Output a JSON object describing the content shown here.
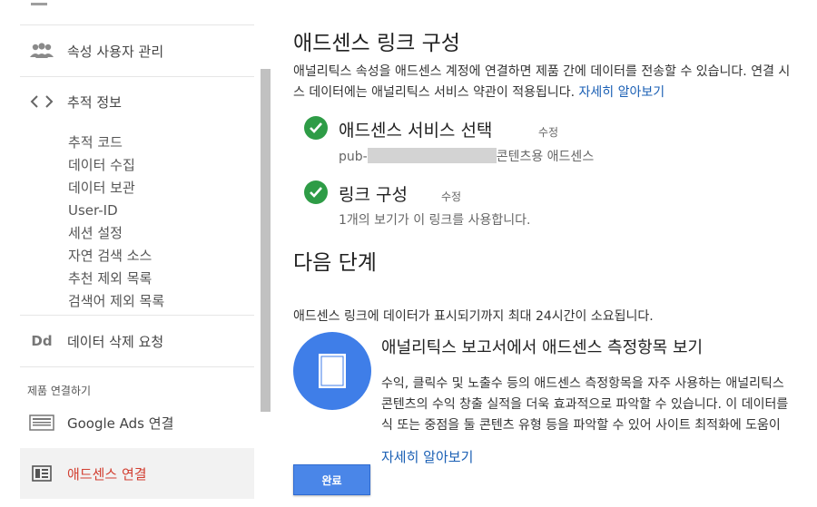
{
  "sidebar": {
    "user_management": "속성 사용자 관리",
    "tracking_info": "추적 정보",
    "tracking_subitems": [
      "추적 코드",
      "데이터 수집",
      "데이터 보관",
      "User-ID",
      "세션 설정",
      "자연 검색 소스",
      "추천 제외 목록",
      "검색어 제외 목록"
    ],
    "data_deletion": "데이터 삭제 요청",
    "section_label": "제품 연결하기",
    "google_ads": "Google Ads 연결",
    "adsense": "애드센스 연결"
  },
  "main": {
    "title": "애드센스 링크 구성",
    "desc_line1": "애널리틱스 속성을 애드센스 계정에 연결하면 제품 간에 데이터를 전송할 수 있습니다. 연결 시",
    "desc_line2": "스 데이터에는 애널리틱스 서비스 약관이 적용됩니다.",
    "learn_more": "자세히 알아보기",
    "step1_title": "애드센스 서비스 선택",
    "step1_edit": "수정",
    "step1_sub_prefix": "pub-",
    "step1_sub_suffix": "콘텐츠용 애드센스",
    "step2_title": "링크 구성",
    "step2_edit": "수정",
    "step2_sub": "1개의 보기가 이 링크를 사용합니다.",
    "next_steps": "다음 단계",
    "notice": "애드센스 링크에 데이터가 표시되기까지 최대 24시간이 소요됩니다.",
    "card_title": "애널리틱스 보고서에서 애드센스 측정항목 보기",
    "card_line1": "수익, 클릭수 및 노출수 등의 애드센스 측정항목을 자주 사용하는 애널리틱스",
    "card_line2": "콘텐츠의 수익 창출 실적을 더욱 효과적으로 파악할 수 있습니다. 이 데이터를",
    "card_line3": "식 또는 중점을 둘 콘텐츠 유형 등을 파악할 수 있어 사이트 최적화에 도움이",
    "learn_more2": "자세히 알아보기",
    "done": "완료"
  },
  "colors": {
    "check_green": "#2e9c46",
    "active_red": "#d23f31",
    "link_blue": "#1a5fb4",
    "button_blue": "#4a86e8"
  }
}
